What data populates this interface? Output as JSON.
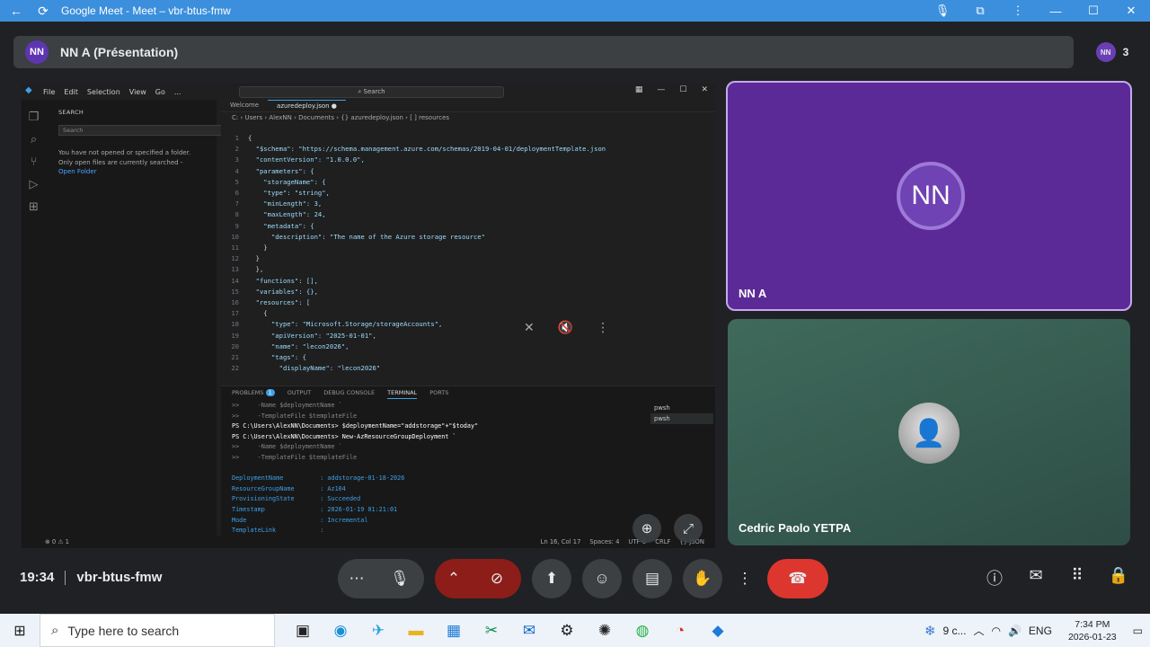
{
  "browser": {
    "title": "Google Meet - Meet – vbr-btus-fmw"
  },
  "meet": {
    "presenter_initials": "NN",
    "presenter_label": "NN A (Présentation)",
    "people_count": "3",
    "meeting_time": "19:34",
    "meeting_code": "vbr-btus-fmw"
  },
  "tiles": [
    {
      "name": "NN A",
      "initials": "NN"
    },
    {
      "name": "Cedric Paolo YETPA"
    }
  ],
  "vscode": {
    "menu": [
      "File",
      "Edit",
      "Selection",
      "View",
      "Go",
      "..."
    ],
    "search_placeholder": "Search",
    "sidebar_header": "SEARCH",
    "sidebar_search_placeholder": "Search",
    "sidebar_msg1": "You have not opened or specified a folder.",
    "sidebar_msg2": "Only open files are currently searched -",
    "open_folder": "Open Folder",
    "tabs": [
      "Welcome",
      "azuredeploy.json"
    ],
    "breadcrumb": "C: › Users › AlexNN › Documents › {} azuredeploy.json › [ ] resources",
    "code": [
      {
        "n": "1",
        "t": "{"
      },
      {
        "n": "2",
        "t": "  \"$schema\": \"https://schema.management.azure.com/schemas/2019-04-01/deploymentTemplate.json"
      },
      {
        "n": "3",
        "t": "  \"contentVersion\": \"1.0.0.0\","
      },
      {
        "n": "4",
        "t": "  \"parameters\": {"
      },
      {
        "n": "5",
        "t": "    \"storageName\": {"
      },
      {
        "n": "6",
        "t": "    \"type\": \"string\","
      },
      {
        "n": "7",
        "t": "    \"minLength\": 3,"
      },
      {
        "n": "8",
        "t": "    \"maxLength\": 24,"
      },
      {
        "n": "9",
        "t": "    \"metadata\": {"
      },
      {
        "n": "10",
        "t": "      \"description\": \"The name of the Azure storage resource\""
      },
      {
        "n": "11",
        "t": "    }"
      },
      {
        "n": "12",
        "t": "  }"
      },
      {
        "n": "13",
        "t": "  },"
      },
      {
        "n": "14",
        "t": "  \"functions\": [],"
      },
      {
        "n": "15",
        "t": "  \"variables\": {},"
      },
      {
        "n": "16",
        "t": "  \"resources\": ["
      },
      {
        "n": "17",
        "t": "    {"
      },
      {
        "n": "18",
        "t": "      \"type\": \"Microsoft.Storage/storageAccounts\","
      },
      {
        "n": "19",
        "t": "      \"apiVersion\": \"2025-01-01\","
      },
      {
        "n": "20",
        "t": "      \"name\": \"lecon2026\","
      },
      {
        "n": "21",
        "t": "      \"tags\": {"
      },
      {
        "n": "22",
        "t": "        \"displayName\": \"lecon2026\""
      }
    ],
    "panel_tabs": [
      "PROBLEMS",
      "OUTPUT",
      "DEBUG CONSOLE",
      "TERMINAL",
      "PORTS"
    ],
    "problems_count": "1",
    "terminal": [
      ">>     -Name $deploymentName `",
      ">>     -TemplateFile $templateFile",
      "PS C:\\Users\\AlexNN\\Documents> $deploymentName=\"addstorage\"+\"$today\"",
      "PS C:\\Users\\AlexNN\\Documents> New-AzResourceGroupDeployment `",
      ">>     -Name $deploymentName `",
      ">>     -TemplateFile $templateFile",
      "",
      "DeploymentName          : addstorage-01-18-2026",
      "ResourceGroupName       : Az104",
      "ProvisioningState       : Succeeded",
      "Timestamp               : 2026-01-19 01:21:01",
      "Mode                    : Incremental",
      "TemplateLink            :"
    ],
    "terminals": [
      "pwsh",
      "pwsh"
    ],
    "status_left": "⊗ 0 ⚠ 1",
    "status_right": [
      "Ln 16, Col 17",
      "Spaces: 4",
      "UTF-8",
      "CRLF",
      "{} JSON"
    ]
  },
  "taskbar": {
    "search_placeholder": "Type here to search",
    "weather": "9 c...",
    "lang": "ENG",
    "time": "7:34 PM",
    "date": "2026-01-23"
  }
}
